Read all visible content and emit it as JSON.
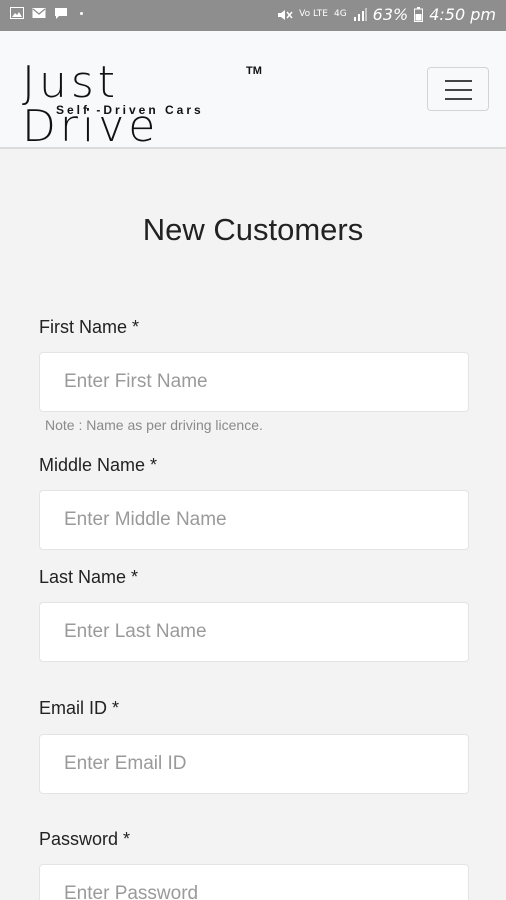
{
  "status_bar": {
    "battery": "63%",
    "time": "4:50 pm",
    "network_label": "Vo LTE",
    "data_label": "4G",
    "icons": [
      "image-icon",
      "mail-icon",
      "message-icon",
      "mute-icon",
      "signal-icon",
      "battery-icon"
    ]
  },
  "brand": {
    "name": "Just Drive",
    "tm": "TM",
    "tagline": "Self -Driven Cars"
  },
  "page": {
    "title": "New Customers"
  },
  "form": {
    "first_name": {
      "label": "First Name *",
      "placeholder": "Enter First Name",
      "note": "Note : Name as per driving licence."
    },
    "middle_name": {
      "label": "Middle Name *",
      "placeholder": "Enter Middle Name"
    },
    "last_name": {
      "label": "Last Name *",
      "placeholder": "Enter Last Name"
    },
    "email": {
      "label": "Email ID *",
      "placeholder": "Enter Email ID"
    },
    "password": {
      "label": "Password *",
      "placeholder": "Enter Password"
    }
  }
}
